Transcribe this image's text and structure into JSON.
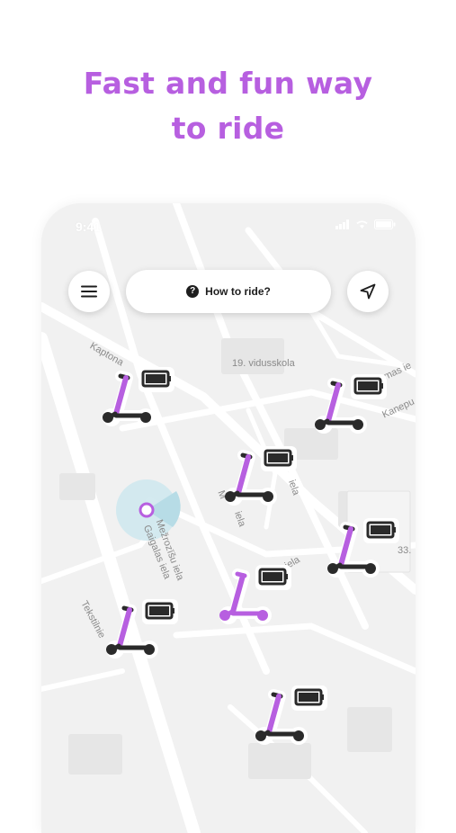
{
  "headline": {
    "line1": "Fast and fun way",
    "line2": "to ride"
  },
  "status_bar": {
    "time": "9:41"
  },
  "top_bar": {
    "how_to_ride_label": "How to ride?",
    "help_icon_glyph": "?"
  },
  "map_labels": {
    "school": "19. vidusskola",
    "kaptona": "Kaptona",
    "mezrozisu": "Mežrozīšu iela",
    "gaigalas": "Gaigalas iela",
    "tekstilnieku": "Tekstilnie",
    "iela_mid": "iela",
    "iela_short": "iela",
    "m_label": "M",
    "u_iela": "u iela",
    "tomas": "omas ie",
    "kanepu": "Kanepu",
    "num_33": "33."
  },
  "colors": {
    "accent": "#b75fe0",
    "scooter_dark": "#2a2a2a",
    "map_bg": "#f1f1f1"
  },
  "scooters": [
    {
      "id": "s1",
      "state": "available"
    },
    {
      "id": "s2",
      "state": "available"
    },
    {
      "id": "s3",
      "state": "available"
    },
    {
      "id": "s4",
      "state": "available"
    },
    {
      "id": "s5",
      "state": "selected"
    },
    {
      "id": "s6",
      "state": "available"
    },
    {
      "id": "s7",
      "state": "available"
    }
  ]
}
